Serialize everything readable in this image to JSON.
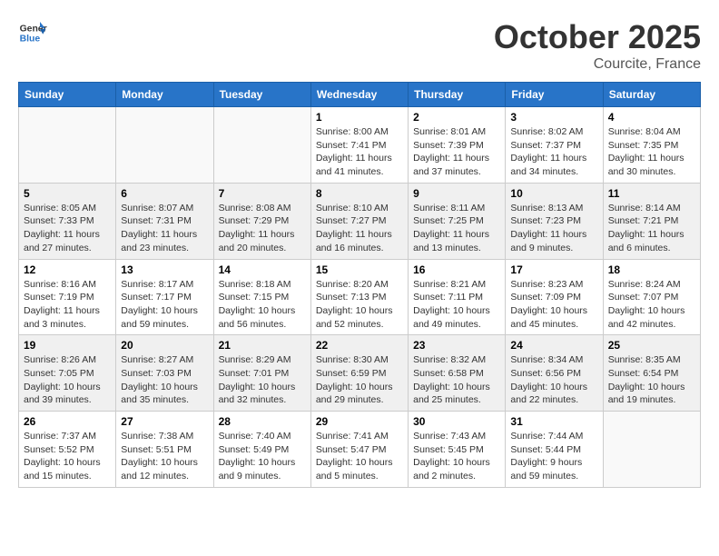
{
  "header": {
    "logo_general": "General",
    "logo_blue": "Blue",
    "month": "October 2025",
    "location": "Courcite, France"
  },
  "days_of_week": [
    "Sunday",
    "Monday",
    "Tuesday",
    "Wednesday",
    "Thursday",
    "Friday",
    "Saturday"
  ],
  "weeks": [
    {
      "days": [
        {
          "num": "",
          "info": ""
        },
        {
          "num": "",
          "info": ""
        },
        {
          "num": "",
          "info": ""
        },
        {
          "num": "1",
          "info": "Sunrise: 8:00 AM\nSunset: 7:41 PM\nDaylight: 11 hours\nand 41 minutes."
        },
        {
          "num": "2",
          "info": "Sunrise: 8:01 AM\nSunset: 7:39 PM\nDaylight: 11 hours\nand 37 minutes."
        },
        {
          "num": "3",
          "info": "Sunrise: 8:02 AM\nSunset: 7:37 PM\nDaylight: 11 hours\nand 34 minutes."
        },
        {
          "num": "4",
          "info": "Sunrise: 8:04 AM\nSunset: 7:35 PM\nDaylight: 11 hours\nand 30 minutes."
        }
      ]
    },
    {
      "days": [
        {
          "num": "5",
          "info": "Sunrise: 8:05 AM\nSunset: 7:33 PM\nDaylight: 11 hours\nand 27 minutes."
        },
        {
          "num": "6",
          "info": "Sunrise: 8:07 AM\nSunset: 7:31 PM\nDaylight: 11 hours\nand 23 minutes."
        },
        {
          "num": "7",
          "info": "Sunrise: 8:08 AM\nSunset: 7:29 PM\nDaylight: 11 hours\nand 20 minutes."
        },
        {
          "num": "8",
          "info": "Sunrise: 8:10 AM\nSunset: 7:27 PM\nDaylight: 11 hours\nand 16 minutes."
        },
        {
          "num": "9",
          "info": "Sunrise: 8:11 AM\nSunset: 7:25 PM\nDaylight: 11 hours\nand 13 minutes."
        },
        {
          "num": "10",
          "info": "Sunrise: 8:13 AM\nSunset: 7:23 PM\nDaylight: 11 hours\nand 9 minutes."
        },
        {
          "num": "11",
          "info": "Sunrise: 8:14 AM\nSunset: 7:21 PM\nDaylight: 11 hours\nand 6 minutes."
        }
      ]
    },
    {
      "days": [
        {
          "num": "12",
          "info": "Sunrise: 8:16 AM\nSunset: 7:19 PM\nDaylight: 11 hours\nand 3 minutes."
        },
        {
          "num": "13",
          "info": "Sunrise: 8:17 AM\nSunset: 7:17 PM\nDaylight: 10 hours\nand 59 minutes."
        },
        {
          "num": "14",
          "info": "Sunrise: 8:18 AM\nSunset: 7:15 PM\nDaylight: 10 hours\nand 56 minutes."
        },
        {
          "num": "15",
          "info": "Sunrise: 8:20 AM\nSunset: 7:13 PM\nDaylight: 10 hours\nand 52 minutes."
        },
        {
          "num": "16",
          "info": "Sunrise: 8:21 AM\nSunset: 7:11 PM\nDaylight: 10 hours\nand 49 minutes."
        },
        {
          "num": "17",
          "info": "Sunrise: 8:23 AM\nSunset: 7:09 PM\nDaylight: 10 hours\nand 45 minutes."
        },
        {
          "num": "18",
          "info": "Sunrise: 8:24 AM\nSunset: 7:07 PM\nDaylight: 10 hours\nand 42 minutes."
        }
      ]
    },
    {
      "days": [
        {
          "num": "19",
          "info": "Sunrise: 8:26 AM\nSunset: 7:05 PM\nDaylight: 10 hours\nand 39 minutes."
        },
        {
          "num": "20",
          "info": "Sunrise: 8:27 AM\nSunset: 7:03 PM\nDaylight: 10 hours\nand 35 minutes."
        },
        {
          "num": "21",
          "info": "Sunrise: 8:29 AM\nSunset: 7:01 PM\nDaylight: 10 hours\nand 32 minutes."
        },
        {
          "num": "22",
          "info": "Sunrise: 8:30 AM\nSunset: 6:59 PM\nDaylight: 10 hours\nand 29 minutes."
        },
        {
          "num": "23",
          "info": "Sunrise: 8:32 AM\nSunset: 6:58 PM\nDaylight: 10 hours\nand 25 minutes."
        },
        {
          "num": "24",
          "info": "Sunrise: 8:34 AM\nSunset: 6:56 PM\nDaylight: 10 hours\nand 22 minutes."
        },
        {
          "num": "25",
          "info": "Sunrise: 8:35 AM\nSunset: 6:54 PM\nDaylight: 10 hours\nand 19 minutes."
        }
      ]
    },
    {
      "days": [
        {
          "num": "26",
          "info": "Sunrise: 7:37 AM\nSunset: 5:52 PM\nDaylight: 10 hours\nand 15 minutes."
        },
        {
          "num": "27",
          "info": "Sunrise: 7:38 AM\nSunset: 5:51 PM\nDaylight: 10 hours\nand 12 minutes."
        },
        {
          "num": "28",
          "info": "Sunrise: 7:40 AM\nSunset: 5:49 PM\nDaylight: 10 hours\nand 9 minutes."
        },
        {
          "num": "29",
          "info": "Sunrise: 7:41 AM\nSunset: 5:47 PM\nDaylight: 10 hours\nand 5 minutes."
        },
        {
          "num": "30",
          "info": "Sunrise: 7:43 AM\nSunset: 5:45 PM\nDaylight: 10 hours\nand 2 minutes."
        },
        {
          "num": "31",
          "info": "Sunrise: 7:44 AM\nSunset: 5:44 PM\nDaylight: 9 hours\nand 59 minutes."
        },
        {
          "num": "",
          "info": ""
        }
      ]
    }
  ]
}
